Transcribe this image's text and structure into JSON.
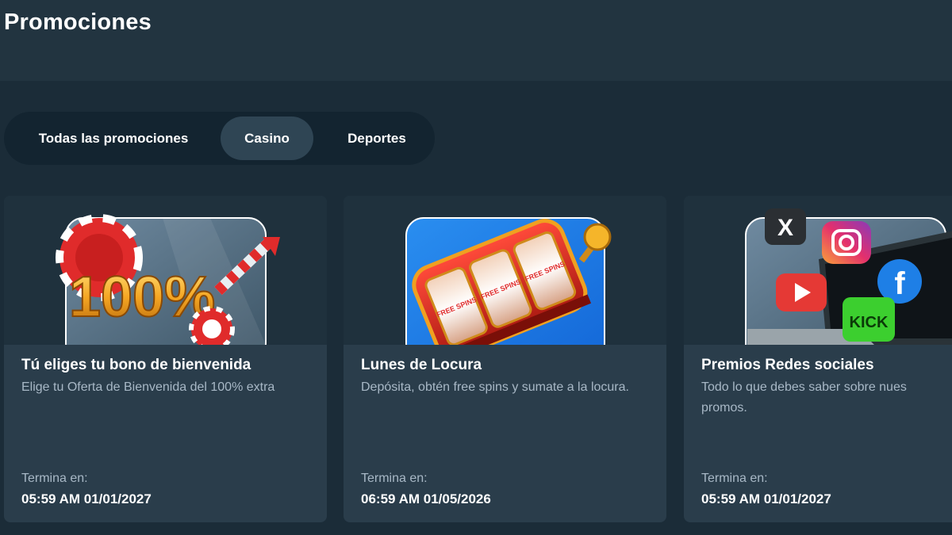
{
  "header": {
    "title": "Promociones"
  },
  "tabs": [
    {
      "label": "Todas las promociones",
      "active": false
    },
    {
      "label": "Casino",
      "active": true
    },
    {
      "label": "Deportes",
      "active": false
    }
  ],
  "promotions": [
    {
      "title": "Tú eliges tu bono de bienvenida",
      "description": "Elige tu Oferta de Bienvenida del 100% extra",
      "ends_label": "Termina en:",
      "ends_value": "05:59 AM 01/01/2027",
      "image": {
        "icon": "bonus-100-percent-icon",
        "text": "100%"
      }
    },
    {
      "title": "Lunes de Locura",
      "description": "Depósita, obtén free spins y sumate a la locura.",
      "ends_label": "Termina en:",
      "ends_value": "06:59 AM 01/05/2026",
      "image": {
        "icon": "slot-machine-icon",
        "reel_text": "FREE SPINS"
      }
    },
    {
      "title": "Premios Redes sociales",
      "description": "Todo lo que debes saber sobre nues",
      "description_2": "promos.",
      "ends_label": "Termina en:",
      "ends_value": "05:59 AM 01/01/2027",
      "image": {
        "icon": "social-media-icon",
        "x_label": "X",
        "kick_label": "KICK",
        "fb_label": "f"
      }
    }
  ],
  "colors": {
    "background": "#1b2c38",
    "header": "#223440",
    "card": "#2a3d4b",
    "tab_active": "#2f4554",
    "muted_text": "#a8b8c6"
  }
}
